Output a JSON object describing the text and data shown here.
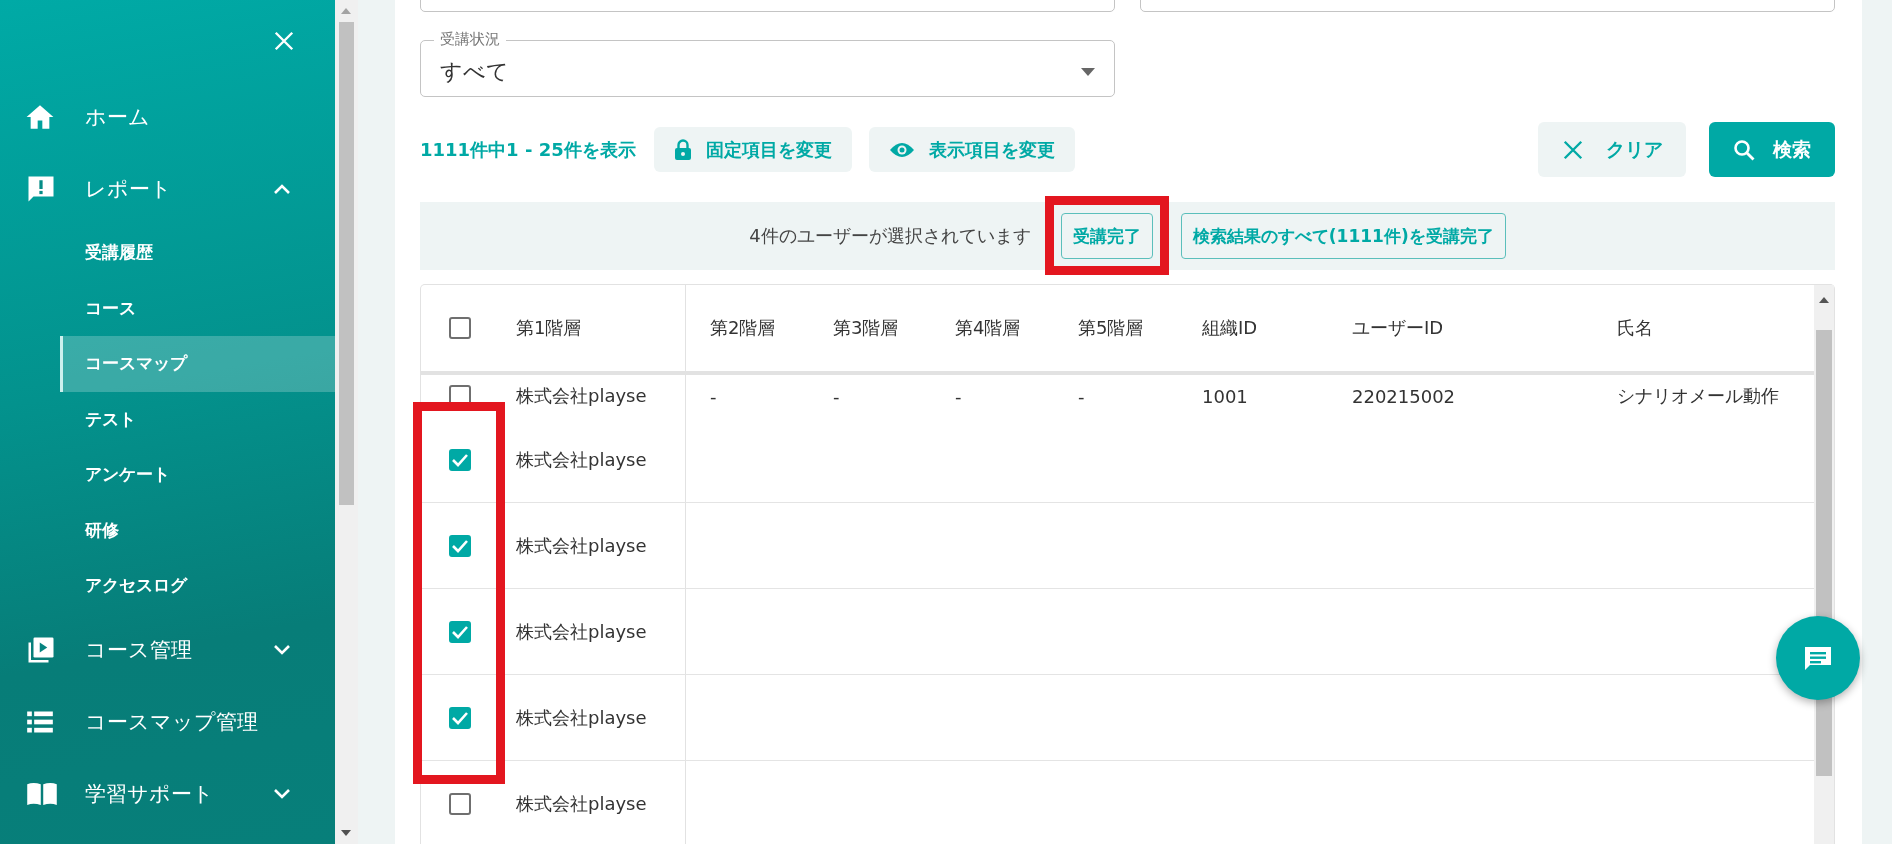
{
  "sidebar": {
    "items": [
      {
        "label": "ホーム",
        "kind": "link"
      },
      {
        "label": "レポート",
        "kind": "group",
        "expanded": true,
        "children": [
          {
            "label": "受講履歴",
            "selected": false
          },
          {
            "label": "コース",
            "selected": false
          },
          {
            "label": "コースマップ",
            "selected": true
          },
          {
            "label": "テスト",
            "selected": false
          },
          {
            "label": "アンケート",
            "selected": false
          },
          {
            "label": "研修",
            "selected": false
          },
          {
            "label": "アクセスログ",
            "selected": false
          }
        ]
      },
      {
        "label": "コース管理",
        "kind": "group",
        "expanded": false
      },
      {
        "label": "コースマップ管理",
        "kind": "link"
      },
      {
        "label": "学習サポート",
        "kind": "group",
        "expanded": false
      }
    ]
  },
  "filters": {
    "status": {
      "label": "受講状況",
      "value": "すべて"
    }
  },
  "toolbar": {
    "count": "1111件中1 - 25件を表示",
    "buttons": [
      "固定項目を変更",
      "表示項目を変更"
    ],
    "clear": "クリア",
    "search": "検索"
  },
  "selection_bar": {
    "message": "4件のユーザーが選択されています",
    "actions": [
      "受講完了",
      "検索結果のすべて(1111件)を受講完了"
    ]
  },
  "table": {
    "select_all": false,
    "columns": [
      "第1階層",
      "第2階層",
      "第3階層",
      "第4階層",
      "第5階層",
      "組織ID",
      "ユーザーID",
      "氏名"
    ],
    "rows": [
      {
        "checked": false,
        "cells": [
          "株式会社playse",
          "-",
          "-",
          "-",
          "-",
          "1001",
          "220215002",
          "シナリオメール動作"
        ]
      },
      {
        "checked": true,
        "cells": [
          "株式会社playse"
        ]
      },
      {
        "checked": true,
        "cells": [
          "株式会社playse"
        ]
      },
      {
        "checked": true,
        "cells": [
          "株式会社playse"
        ]
      },
      {
        "checked": true,
        "cells": [
          "株式会社playse"
        ]
      },
      {
        "checked": false,
        "cells": [
          "株式会社playse"
        ]
      }
    ]
  }
}
